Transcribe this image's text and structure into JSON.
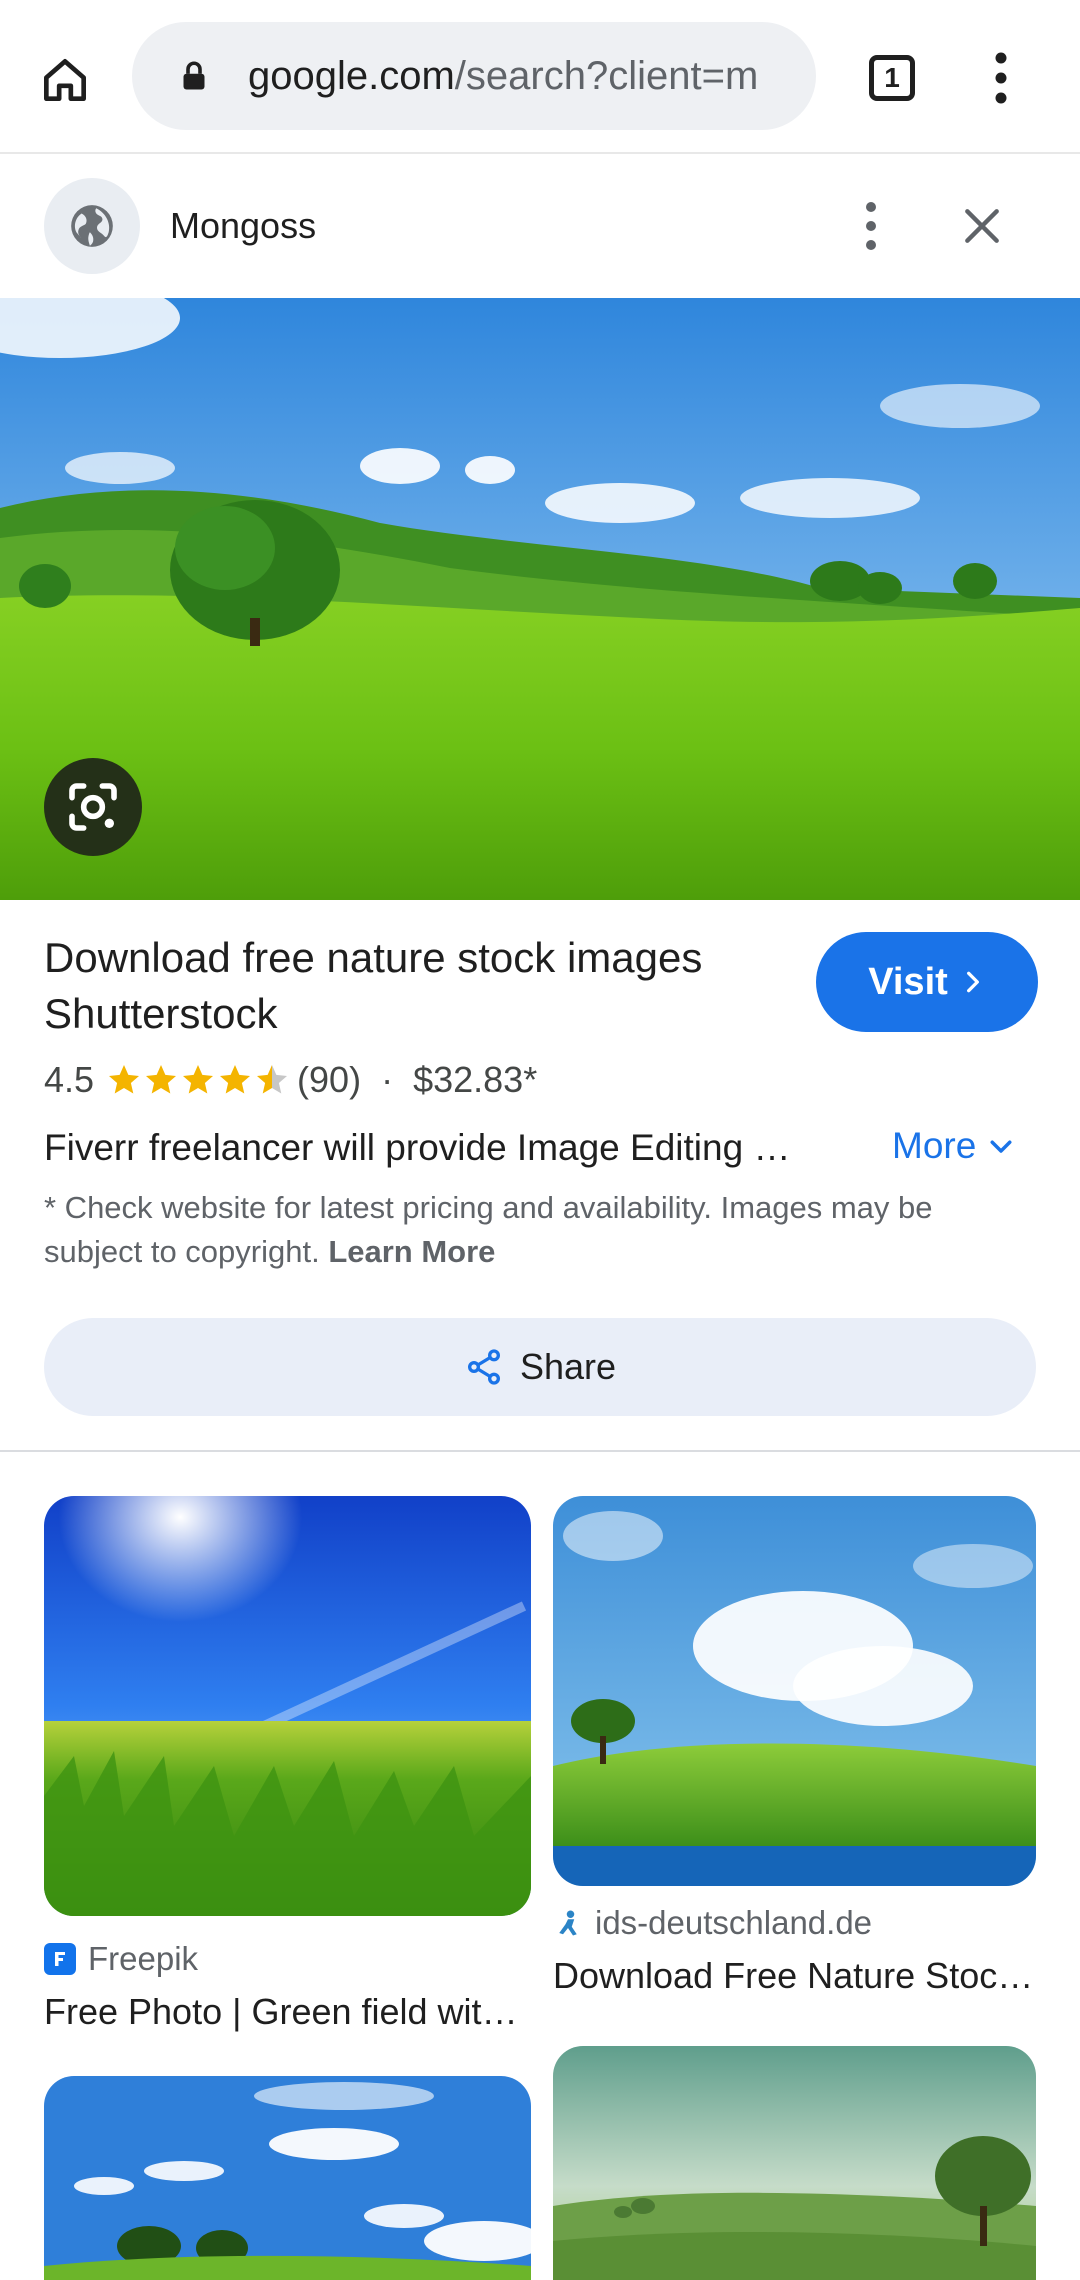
{
  "browser": {
    "url_host": "google.com",
    "url_path": "/search?client=m",
    "tab_count": "1"
  },
  "sheet": {
    "site_name": "Mongoss"
  },
  "result": {
    "title": "Download free nature stock images Shutterstock",
    "visit_label": "Visit",
    "rating": "4.5",
    "rating_value": 4.5,
    "review_count": "(90)",
    "separator": "·",
    "price": "$32.83*",
    "description": "Fiverr freelancer will provide Image Editing services and do image cleanup, clipping paths",
    "more_label": "More",
    "disclaimer": "* Check website for latest pricing and availability. Images may be subject to copyright.",
    "learn_more": "Learn More",
    "share_label": "Share"
  },
  "related": [
    {
      "source": "Freepik",
      "title": "Free Photo | Green field with blue sky"
    },
    {
      "source": "ids-deutschland.de",
      "title": "Download Free Nature Stock Images"
    }
  ],
  "colors": {
    "accent": "#1a73e8",
    "star": "#f4b400"
  }
}
